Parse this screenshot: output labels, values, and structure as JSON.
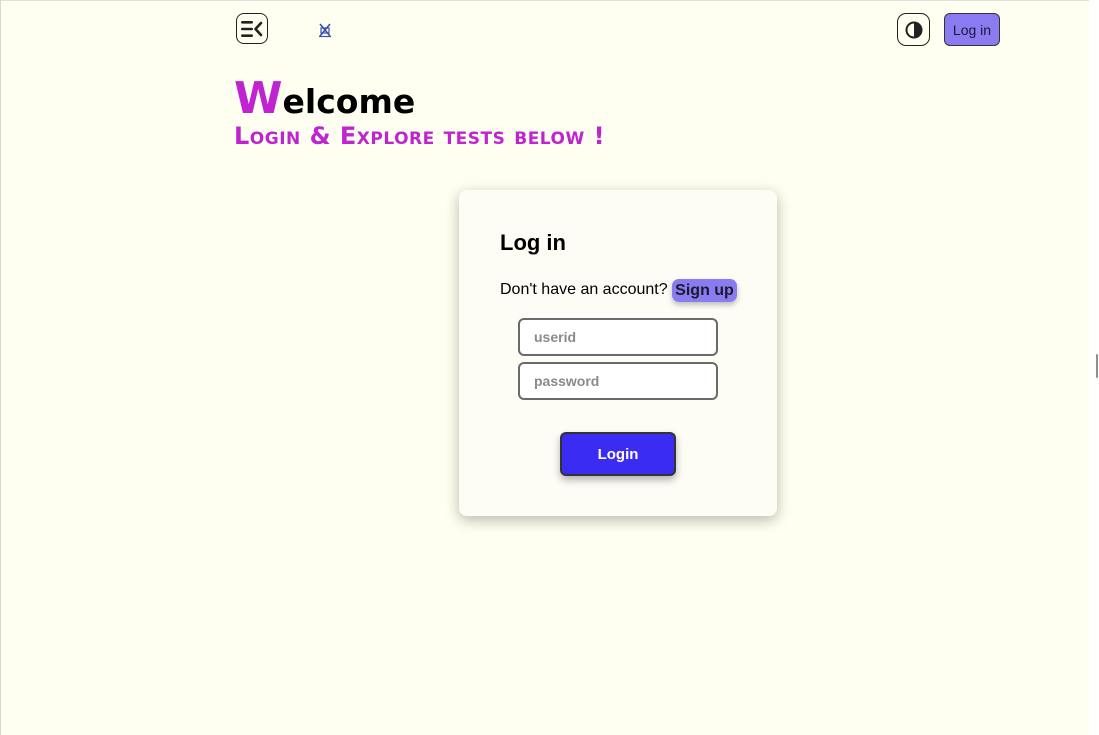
{
  "header": {
    "menu_icon": "menu-collapse-icon",
    "logo_icon": "app-logo-icon",
    "theme_icon": "contrast-icon",
    "login_label": "Log in"
  },
  "hero": {
    "welcome_initial": "W",
    "welcome_rest": "elcome",
    "subtitle": "Login & Explore tests below !"
  },
  "login_card": {
    "title": "Log in",
    "prompt": "Don't have an account?",
    "signup_label": "Sign up",
    "userid": {
      "value": "",
      "placeholder": "userid"
    },
    "password": {
      "value": "",
      "placeholder": "password"
    },
    "submit_label": "Login"
  },
  "colors": {
    "background": "#fefff0",
    "accent_magenta": "#c024d0",
    "button_purple": "#8a7cf0",
    "login_blue": "#3a2cf2"
  }
}
